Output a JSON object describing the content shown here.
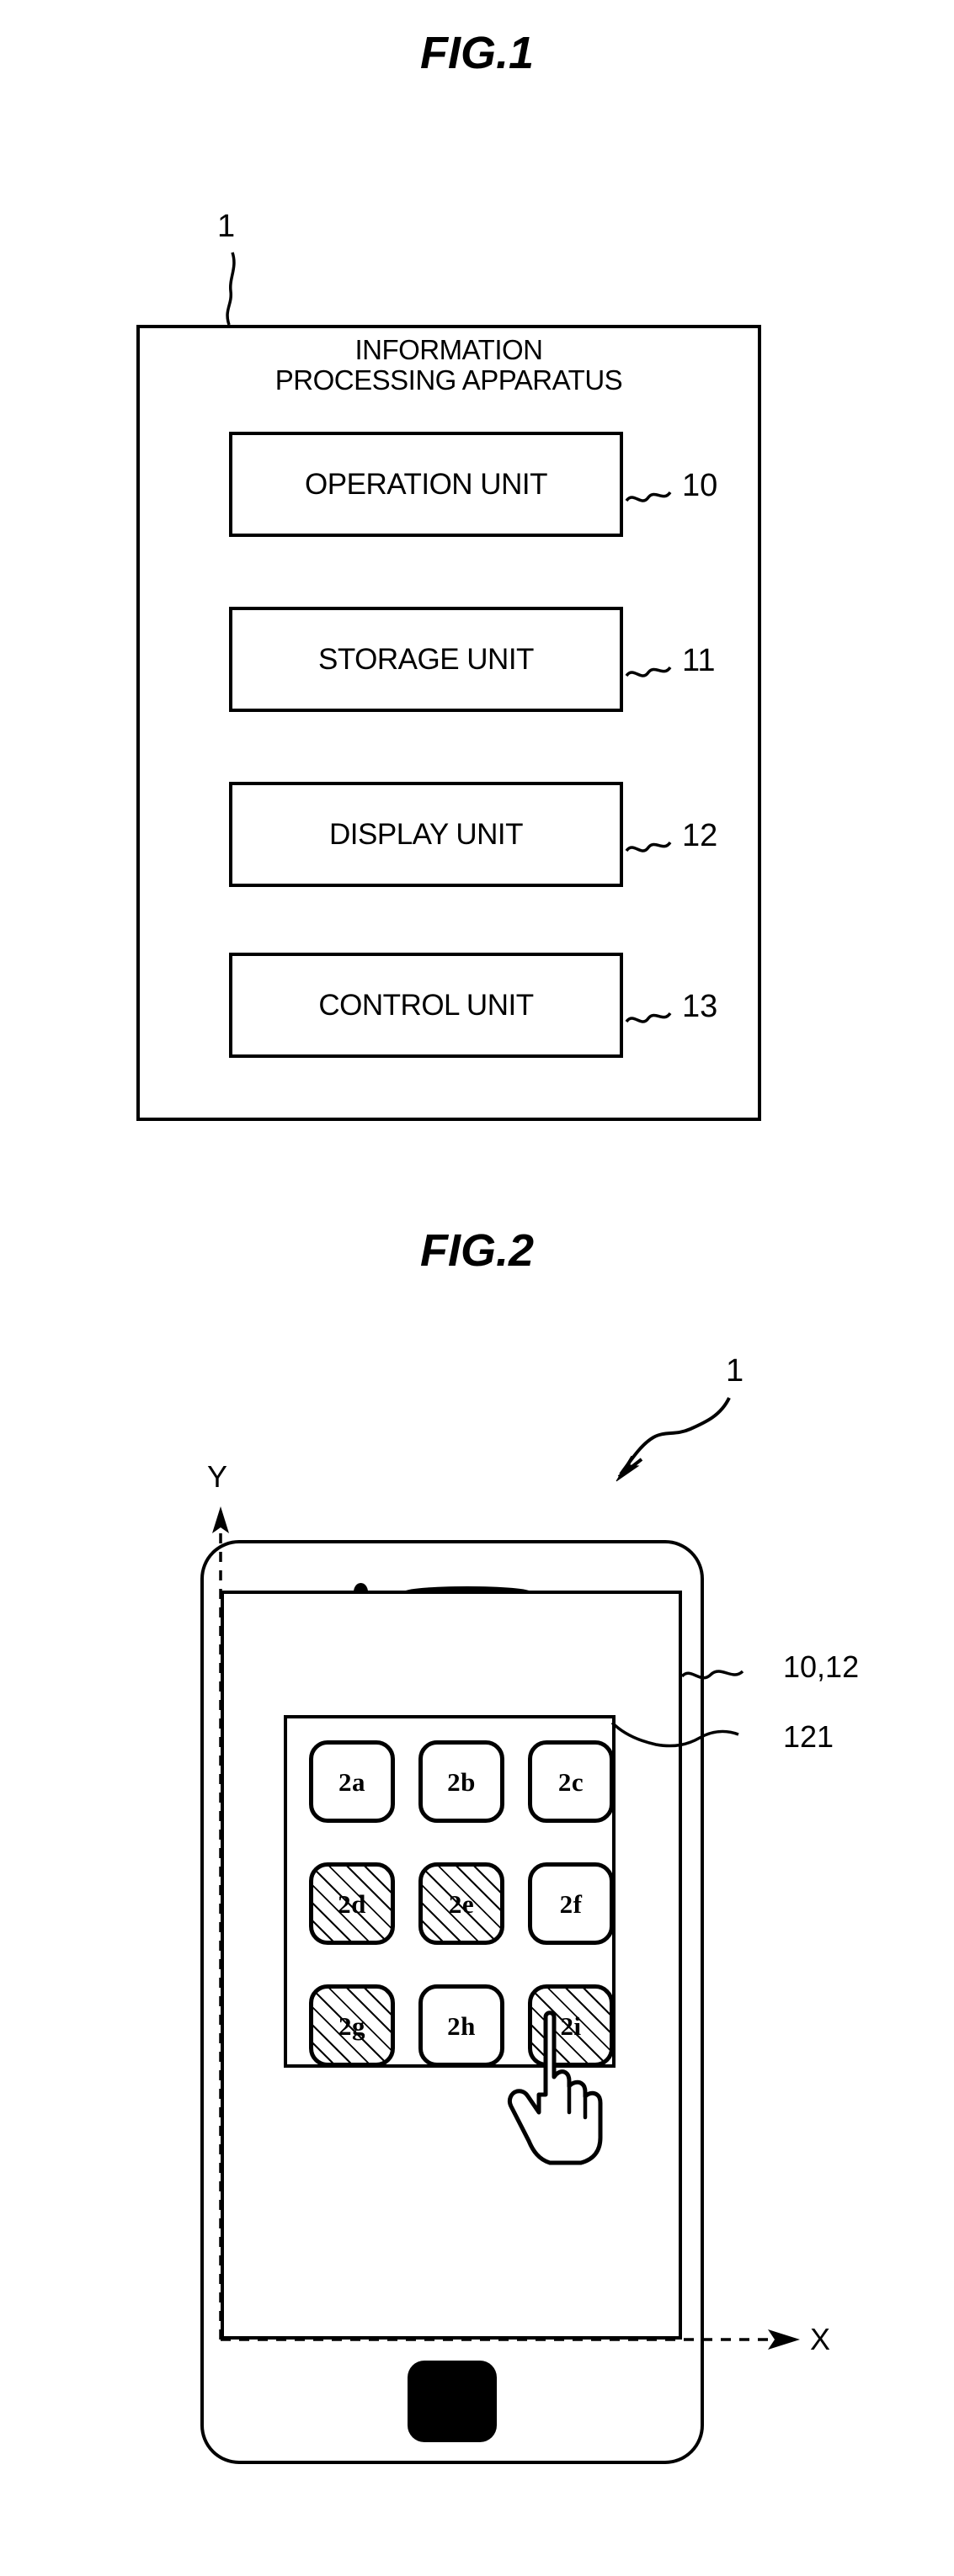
{
  "figures": {
    "fig1": {
      "title": "FIG.1",
      "apparatus": {
        "ref": "1",
        "title_line1": "INFORMATION",
        "title_line2": "PROCESSING APPARATUS"
      },
      "units": [
        {
          "label": "OPERATION UNIT",
          "ref": "10"
        },
        {
          "label": "STORAGE UNIT",
          "ref": "11"
        },
        {
          "label": "DISPLAY UNIT",
          "ref": "12"
        },
        {
          "label": "CONTROL UNIT",
          "ref": "13"
        }
      ]
    },
    "fig2": {
      "title": "FIG.2",
      "device_ref": "1",
      "display_ref": "10,12",
      "panel_ref": "121",
      "axes": {
        "y": "Y",
        "x": "X"
      },
      "keys": [
        {
          "label": "2a",
          "selected": false
        },
        {
          "label": "2b",
          "selected": false
        },
        {
          "label": "2c",
          "selected": false
        },
        {
          "label": "2d",
          "selected": true
        },
        {
          "label": "2e",
          "selected": true
        },
        {
          "label": "2f",
          "selected": false
        },
        {
          "label": "2g",
          "selected": true
        },
        {
          "label": "2h",
          "selected": false
        },
        {
          "label": "2i",
          "selected": true
        }
      ],
      "cursor": "pointing-hand"
    }
  },
  "colors": {
    "ink": "#000000",
    "paper": "#ffffff"
  }
}
